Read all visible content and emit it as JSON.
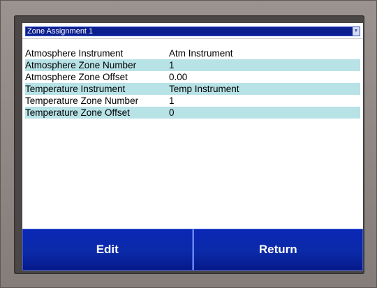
{
  "dropdown": {
    "selected": "Zone Assignment 1",
    "arrow_icon": "chevron-down-icon"
  },
  "rows": [
    {
      "name": "Atmosphere Instrument",
      "value": "Atm Instrument"
    },
    {
      "name": "Atmosphere Zone Number",
      "value": "1"
    },
    {
      "name": "Atmosphere Zone Offset",
      "value": "0.00"
    },
    {
      "name": "Temperature Instrument",
      "value": "Temp Instrument"
    },
    {
      "name": "Temperature Zone Number",
      "value": "1"
    },
    {
      "name": "Temperature Zone Offset",
      "value": "0"
    }
  ],
  "buttons": {
    "edit": "Edit",
    "return": "Return"
  },
  "colors": {
    "row_highlight": "#b7e2e6",
    "button_blue": "#0b2aa8",
    "dropdown_blue": "#0b1f8f"
  }
}
